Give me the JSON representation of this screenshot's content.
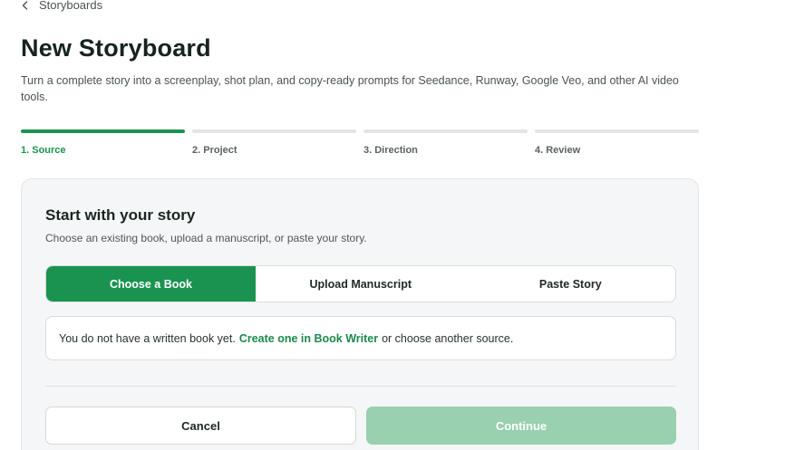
{
  "breadcrumb": {
    "back_label": "Storyboards"
  },
  "header": {
    "title": "New Storyboard",
    "subtitle": "Turn a complete story into a screenplay, shot plan, and copy-ready prompts for Seedance, Runway, Google Veo, and other AI video tools."
  },
  "steps": [
    {
      "label": "1. Source"
    },
    {
      "label": "2. Project"
    },
    {
      "label": "3. Direction"
    },
    {
      "label": "4. Review"
    }
  ],
  "card": {
    "title": "Start with your story",
    "subtitle": "Choose an existing book, upload a manuscript, or paste your story.",
    "tabs": [
      {
        "label": "Choose a Book"
      },
      {
        "label": "Upload Manuscript"
      },
      {
        "label": "Paste Story"
      }
    ],
    "notice": {
      "prefix": "You do not have a written book yet.",
      "link": "Create one in Book Writer",
      "suffix": "or choose another source."
    },
    "cancel_label": "Cancel",
    "continue_label": "Continue"
  },
  "colors": {
    "accent": "#1a9350",
    "accent_disabled": "#99d0af",
    "card_bg": "#f5f6f7"
  }
}
